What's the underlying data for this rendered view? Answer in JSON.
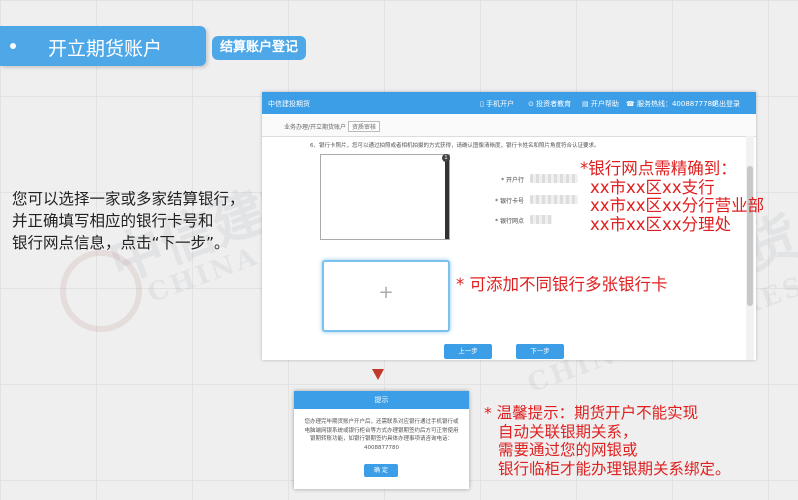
{
  "header": {
    "main_tab": "开立期货账户",
    "sub_tab": "结算账户登记"
  },
  "watermark": {
    "cn": "中信建投期货",
    "en": "CHINA FUTURES"
  },
  "instruction": [
    "您可以选择一家或多家结算银行，",
    "并正确填写相应的银行卡号和",
    "银行网点信息，点击“下一步”。"
  ],
  "screenshot": {
    "nav": {
      "brand": "中信建投期货",
      "mobile": "手机开户",
      "education": "投资者教育",
      "help": "开户帮助",
      "hotline": "服务热线：4008877780",
      "logout": "退出登录"
    },
    "breadcrumb": "业务办理/开立期货账户",
    "breadcrumb_tag": "资质审核",
    "notice": "6、银行卡照片，您可以通过拍照或者相机拍摄的方式获得，请确认图像清晰度，银行卡姓名和照片角度符合认证要求。",
    "card_number_badge": "1",
    "form": {
      "holder_label": "* 开户行",
      "card_label": "* 银行卡号",
      "branch_label": "* 银行网点"
    },
    "add_symbol": "+",
    "prev_button": "上一步",
    "next_button": "下一步"
  },
  "annotations": {
    "branch": [
      "*银行网点需精确到：",
      "xx市xx区xx支行",
      "xx市xx区xx分行营业部",
      "xx市xx区xx分理处"
    ],
    "add_cards": "* 可添加不同银行多张银行卡",
    "tip": [
      "* 温馨提示：期货开户不能实现",
      "自动关联银期关系，",
      "需要通过您的网银或",
      "银行临柜才能办理银期关系绑定。"
    ]
  },
  "dialog": {
    "title": "提示",
    "body": "您办理完毕期货账户开户后，还需联系对应银行通过手机银行或电脑端网银系统或银行柜台等方式办理银期签约后方可正常使用银期转账功能，如银行银期签约具体办理事项请咨询电话：4008877780",
    "ok": "确 定"
  },
  "colors": {
    "accent": "#4ea8e8",
    "nav_blue": "#3c9ee6",
    "annotation_red": "#e02020"
  }
}
